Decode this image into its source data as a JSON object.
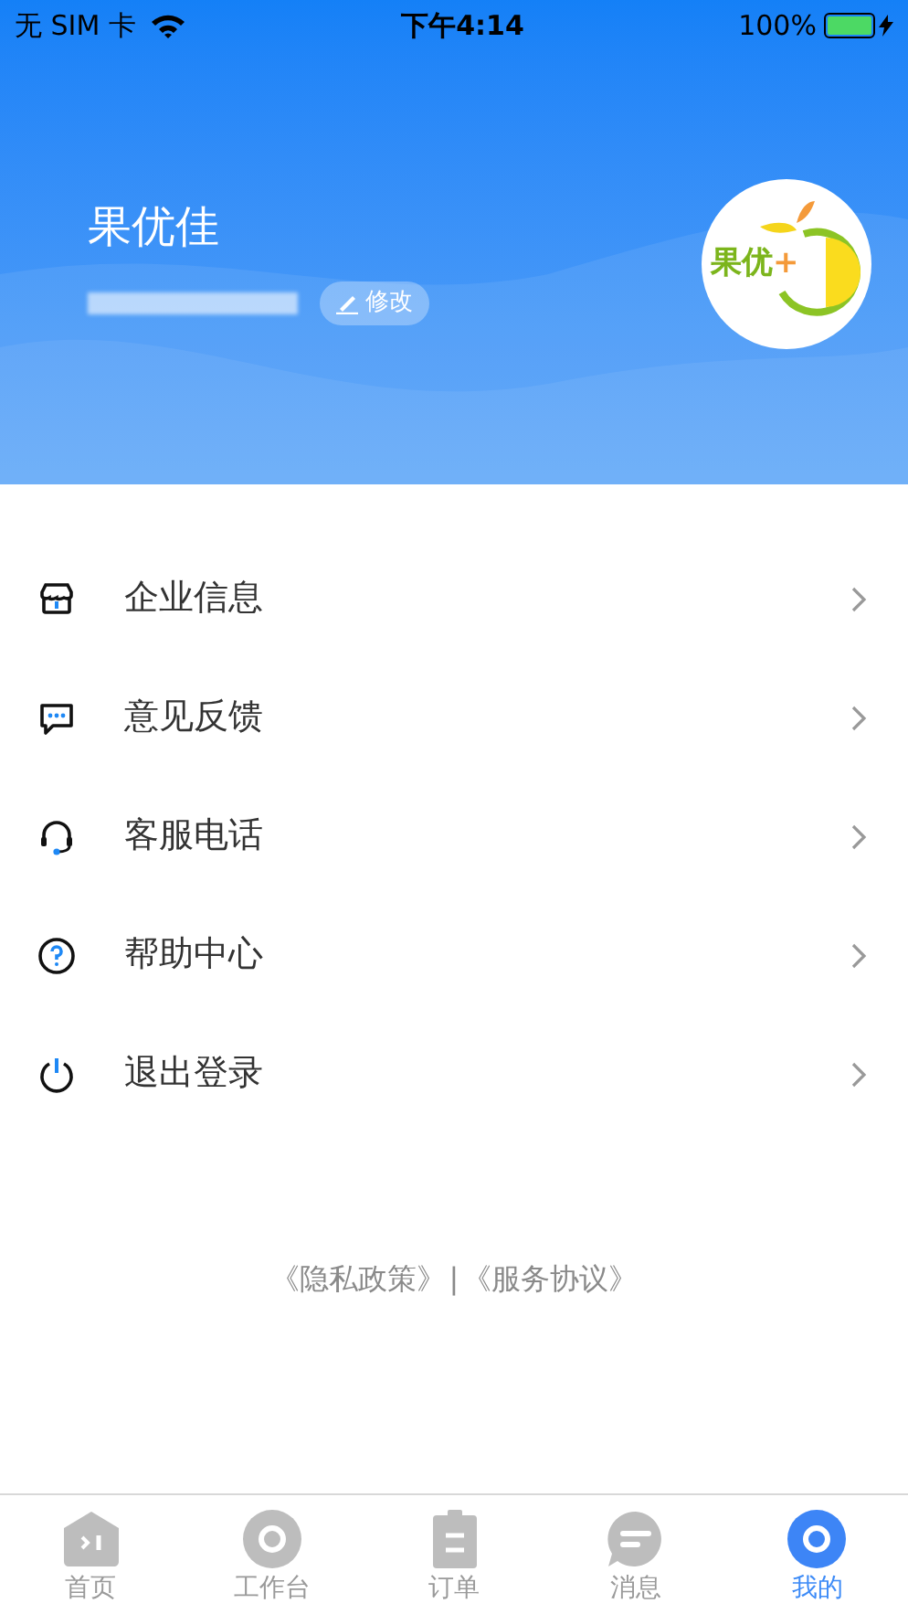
{
  "status_bar": {
    "carrier": "无 SIM 卡",
    "time": "下午4:14",
    "battery_text": "100%"
  },
  "profile": {
    "name": "果优佳",
    "edit_button": "修改",
    "logo_text": "果优",
    "logo_plus": "+"
  },
  "menu": [
    {
      "label": "企业信息",
      "kind": "store"
    },
    {
      "label": "意见反馈",
      "kind": "chat"
    },
    {
      "label": "客服电话",
      "kind": "headset"
    },
    {
      "label": "帮助中心",
      "kind": "help"
    },
    {
      "label": "退出登录",
      "kind": "power"
    }
  ],
  "footer": {
    "links": [
      "《隐私政策》",
      "《服务协议》"
    ],
    "separator": "|"
  },
  "tab_bar": [
    {
      "label": "首页",
      "kind": "home",
      "selected": false
    },
    {
      "label": "工作台",
      "kind": "ring",
      "selected": false
    },
    {
      "label": "订单",
      "kind": "clipboard",
      "selected": false
    },
    {
      "label": "消息",
      "kind": "bubble",
      "selected": false
    },
    {
      "label": "我的",
      "kind": "ring",
      "selected": true
    }
  ]
}
